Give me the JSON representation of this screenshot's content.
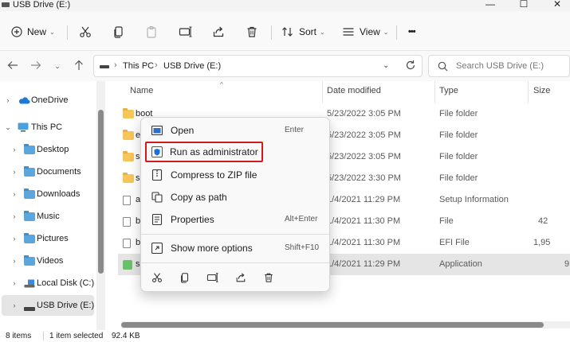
{
  "window": {
    "title": "USB Drive (E:)",
    "buttons": {
      "minimize": "—",
      "maximize": "☐",
      "close": "✕"
    }
  },
  "commandbar": {
    "new_label": "New",
    "sort_label": "Sort",
    "view_label": "View",
    "more_label": "•••"
  },
  "address": {
    "crumbs": [
      "This PC",
      "USB Drive (E:)"
    ],
    "search_placeholder": "Search USB Drive (E:)"
  },
  "sidebar": {
    "items": [
      {
        "label": "OneDrive"
      },
      {
        "label": "This PC"
      },
      {
        "label": "Desktop"
      },
      {
        "label": "Documents"
      },
      {
        "label": "Downloads"
      },
      {
        "label": "Music"
      },
      {
        "label": "Pictures"
      },
      {
        "label": "Videos"
      },
      {
        "label": "Local Disk (C:)"
      },
      {
        "label": "USB Drive (E:)"
      }
    ]
  },
  "filelist": {
    "columns": {
      "name": "Name",
      "date": "Date modified",
      "type": "Type",
      "size": "Size"
    },
    "rows": [
      {
        "name": "boot",
        "date": "5/23/2022 3:05 PM",
        "type": "File folder",
        "size": ""
      },
      {
        "name": "e",
        "date": "5/23/2022 3:05 PM",
        "type": "File folder",
        "size": ""
      },
      {
        "name": "s",
        "date": "5/23/2022 3:05 PM",
        "type": "File folder",
        "size": ""
      },
      {
        "name": "s",
        "date": "5/23/2022 3:30 PM",
        "type": "File folder",
        "size": ""
      },
      {
        "name": "a",
        "date": "1/4/2021 11:29 PM",
        "type": "Setup Information",
        "size": ""
      },
      {
        "name": "b",
        "date": "1/4/2021 11:30 PM",
        "type": "File",
        "size": "42"
      },
      {
        "name": "b",
        "date": "1/4/2021 11:30 PM",
        "type": "EFI File",
        "size": "1,95"
      },
      {
        "name": "s",
        "date": "1/4/2021 11:29 PM",
        "type": "Application",
        "size": "9"
      }
    ]
  },
  "context_menu": {
    "items": [
      {
        "label": "Open",
        "shortcut": "Enter"
      },
      {
        "label": "Run as administrator",
        "shortcut": ""
      },
      {
        "label": "Compress to ZIP file",
        "shortcut": ""
      },
      {
        "label": "Copy as path",
        "shortcut": ""
      },
      {
        "label": "Properties",
        "shortcut": "Alt+Enter"
      },
      {
        "label": "Show more options",
        "shortcut": "Shift+F10"
      }
    ]
  },
  "statusbar": {
    "items_count": "8 items",
    "selected": "1 item selected",
    "size": "92.4 KB"
  },
  "colors": {
    "highlight_border": "#d11a1a",
    "folder": "#f6c65b",
    "library_folder": "#5aa6dd",
    "selection": "#e5e5e5"
  }
}
